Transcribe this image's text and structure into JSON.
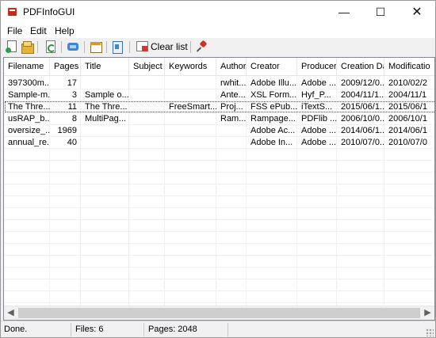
{
  "window": {
    "title": "PDFInfoGUI"
  },
  "menu": {
    "items": [
      "File",
      "Edit",
      "Help"
    ]
  },
  "toolbar": {
    "clear_label": "Clear list"
  },
  "table": {
    "columns": [
      "Filename",
      "Pages",
      "Title",
      "Subject",
      "Keywords",
      "Author",
      "Creator",
      "Producer",
      "Creation Date",
      "Modificatio"
    ],
    "rows": [
      [
        "397300m...",
        "17",
        "",
        "",
        "",
        "rwhit...",
        "Adobe Illu...",
        "Adobe ...",
        "2009/12/0...",
        "2010/02/2"
      ],
      [
        "Sample-m...",
        "3",
        "Sample o...",
        "",
        "",
        "Ante...",
        "XSL Form...",
        "Hyf_P...",
        "2004/11/1...",
        "2004/11/1"
      ],
      [
        "The Thre...",
        "11",
        "The Thre...",
        "",
        "FreeSmart...",
        "Proj...",
        "FSS ePub...",
        "iTextS...",
        "2015/06/1...",
        "2015/06/1"
      ],
      [
        "usRAP_b...",
        "8",
        "MultiPag...",
        "",
        "",
        "Ram...",
        "Rampage...",
        "PDFlib ...",
        "2006/10/0...",
        "2006/10/1"
      ],
      [
        "oversize_...",
        "1969",
        "",
        "",
        "",
        "",
        "Adobe Ac...",
        "Adobe ...",
        "2014/06/1...",
        "2014/06/1"
      ],
      [
        "annual_re...",
        "40",
        "",
        "",
        "",
        "",
        "Adobe In...",
        "Adobe ...",
        "2010/07/0...",
        "2010/07/0"
      ]
    ]
  },
  "status": {
    "text": "Done.",
    "files": "Files: 6",
    "pages": "Pages: 2048"
  },
  "icons": {
    "new": "new-file-icon",
    "open": "open-folder-icon",
    "refresh": "refresh-icon",
    "sync": "sync-icon",
    "props": "properties-icon",
    "export": "export-icon",
    "clear": "clear-list-icon",
    "pin": "pin-icon"
  }
}
